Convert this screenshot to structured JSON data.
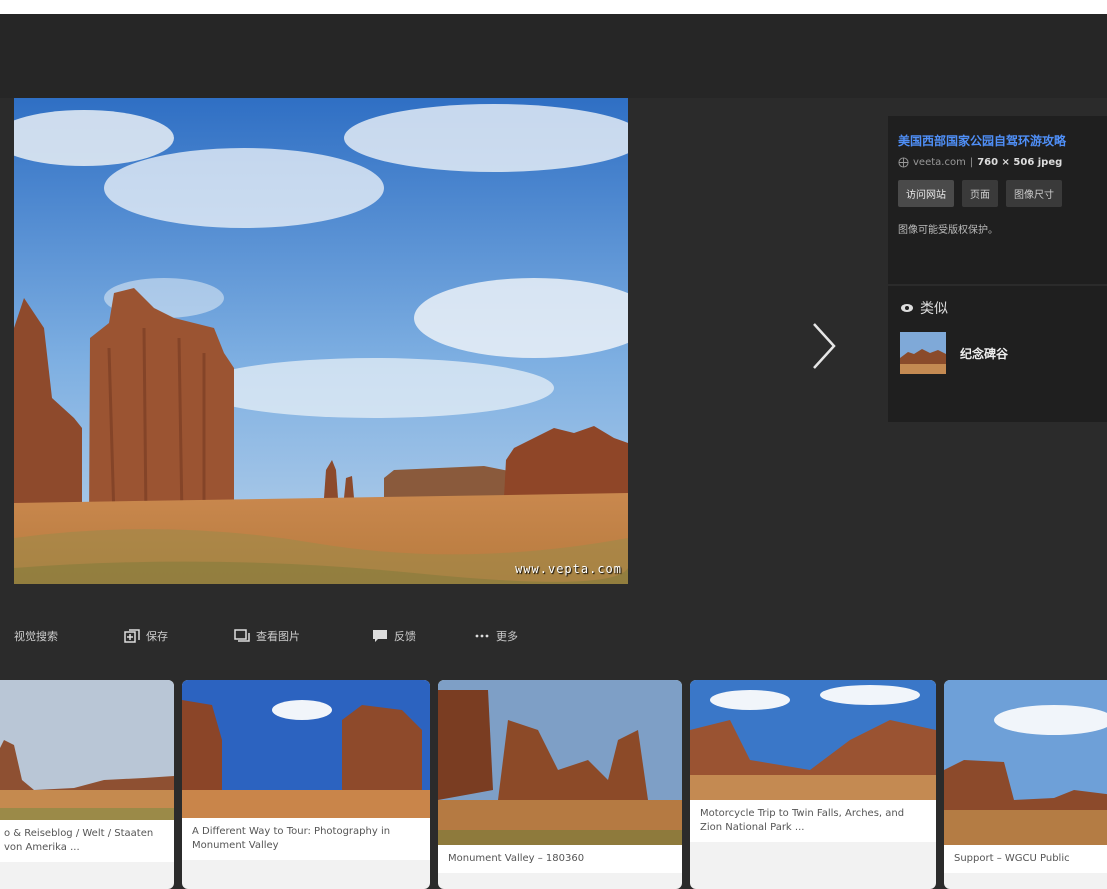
{
  "info_panel": {
    "title": "美国西部国家公园自驾环游攻略",
    "source": "veeta.com",
    "separator": "|",
    "dimensions": "760 × 506 jpeg",
    "buttons": [
      "访问网站",
      "页面",
      "图像尺寸"
    ],
    "copyright_note": "图像可能受版权保护。"
  },
  "similar": {
    "heading": "类似",
    "item_label": "纪念碑谷"
  },
  "hero": {
    "watermark": "www.vepta.com"
  },
  "actions": [
    {
      "label": "视觉搜索",
      "icon": "visual-search-icon"
    },
    {
      "label": "保存",
      "icon": "save-icon"
    },
    {
      "label": "查看图片",
      "icon": "view-image-icon"
    },
    {
      "label": "反馈",
      "icon": "feedback-icon"
    },
    {
      "label": "更多",
      "icon": "more-icon"
    }
  ],
  "gallery": [
    {
      "caption": "o & Reiseblog / Welt / Staaten von Amerika ..."
    },
    {
      "caption": "A Different Way to Tour: Photography in Monument Valley"
    },
    {
      "caption": "Monument Valley – 180360"
    },
    {
      "caption": "Motorcycle Trip to Twin Falls, Arches, and Zion National Park ..."
    },
    {
      "caption": "Support – WGCU Public"
    }
  ],
  "colors": {
    "background": "#2b2b2b",
    "panel": "#1f1f1f",
    "link": "#4f8ff7"
  }
}
